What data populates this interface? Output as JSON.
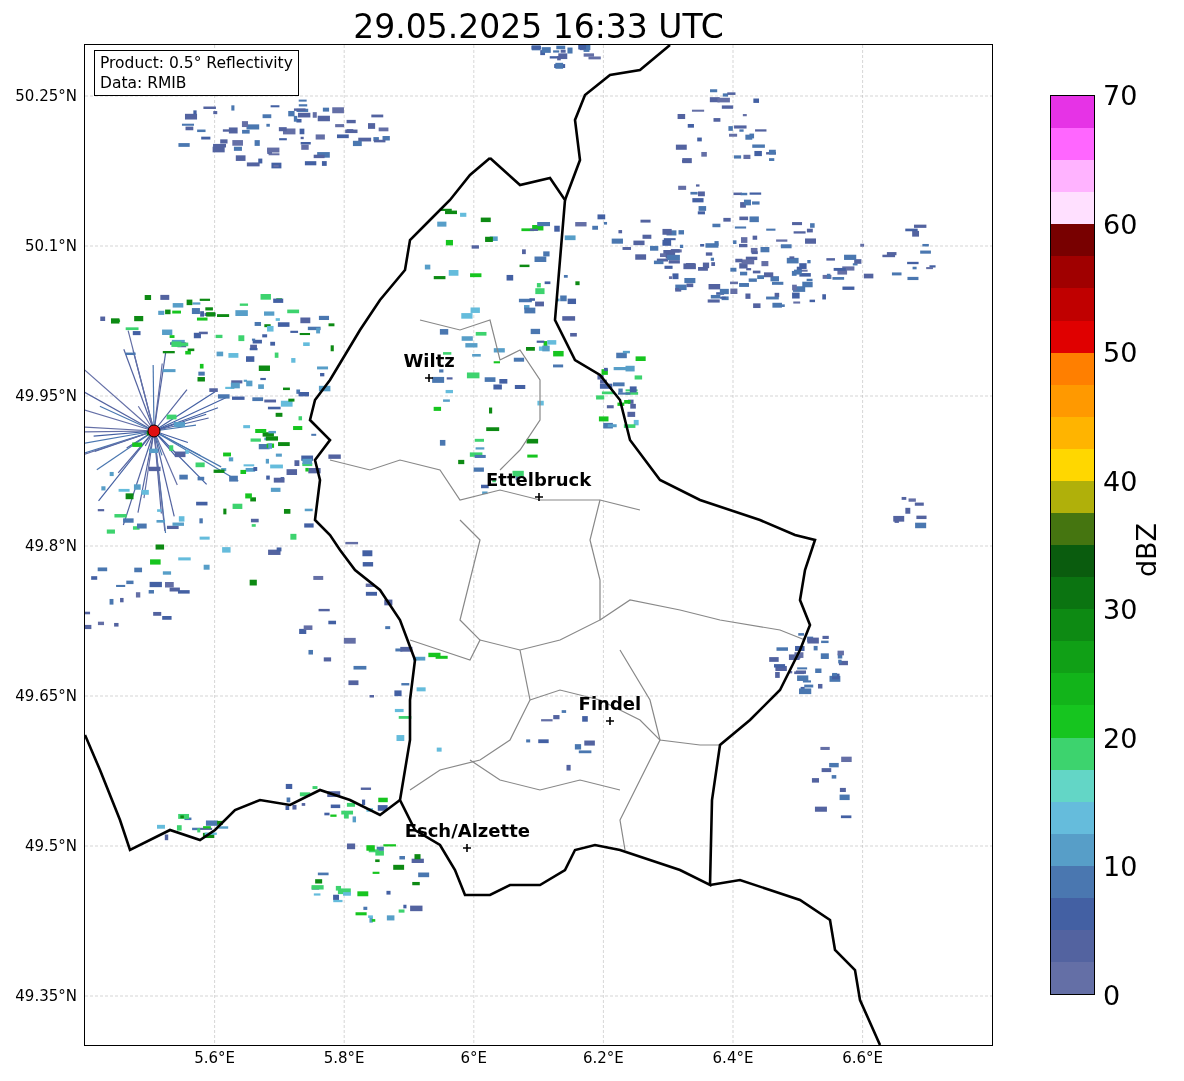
{
  "title": "29.05.2025 16:33 UTC",
  "info_box": {
    "lines": [
      "Product: 0.5° Reflectivity",
      "Data: RMIB"
    ]
  },
  "map": {
    "x_ticks": [
      "5.6°E",
      "5.8°E",
      "6°E",
      "6.2°E",
      "6.4°E",
      "6.6°E"
    ],
    "y_ticks": [
      "50.25°N",
      "50.1°N",
      "49.95°N",
      "49.8°N",
      "49.65°N",
      "49.5°N",
      "49.35°N"
    ],
    "cities": [
      {
        "name": "Wiltz"
      },
      {
        "name": "Ettelbruck"
      },
      {
        "name": "Findel"
      },
      {
        "name": "Esch/Alzette"
      }
    ]
  },
  "colorbar": {
    "label": "dBZ",
    "ticks": [
      "70",
      "60",
      "50",
      "40",
      "30",
      "20",
      "10",
      "0"
    ],
    "segments": [
      {
        "color": "#e633e6"
      },
      {
        "color": "#ff66ff"
      },
      {
        "color": "#ffb3ff"
      },
      {
        "color": "#ffe0ff"
      },
      {
        "color": "#780000"
      },
      {
        "color": "#a00000"
      },
      {
        "color": "#c00000"
      },
      {
        "color": "#e00000"
      },
      {
        "color": "#ff7f00"
      },
      {
        "color": "#ff9900"
      },
      {
        "color": "#ffb400"
      },
      {
        "color": "#ffd700"
      },
      {
        "color": "#b0b00a"
      },
      {
        "color": "#457510"
      },
      {
        "color": "#0a5c0e"
      },
      {
        "color": "#0b7411"
      },
      {
        "color": "#0d8a13"
      },
      {
        "color": "#10a016"
      },
      {
        "color": "#12b41a"
      },
      {
        "color": "#16c51f"
      },
      {
        "color": "#3dd36e"
      },
      {
        "color": "#63d6c6"
      },
      {
        "color": "#65bcdc"
      },
      {
        "color": "#579ec8"
      },
      {
        "color": "#4a77b0"
      },
      {
        "color": "#4360a3"
      },
      {
        "color": "#5363a0"
      },
      {
        "color": "#646fa6"
      }
    ]
  }
}
